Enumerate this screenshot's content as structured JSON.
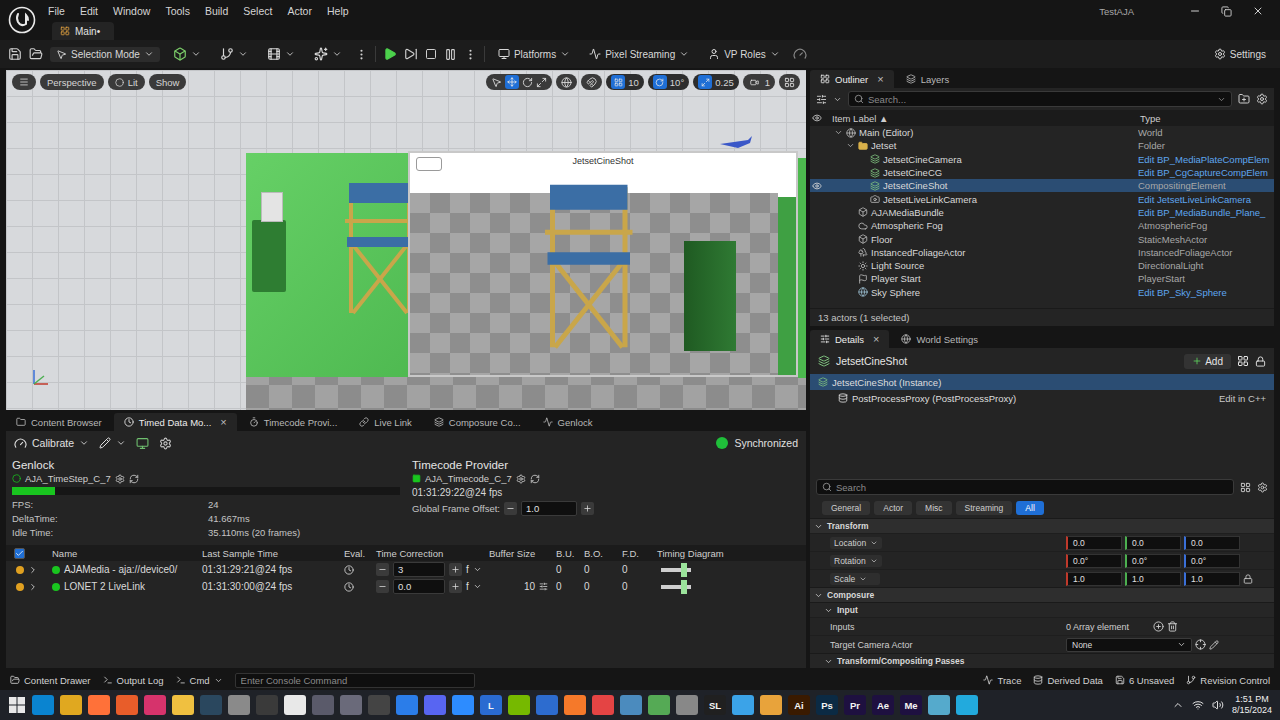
{
  "window": {
    "project": "TestAJA",
    "menu": [
      "File",
      "Edit",
      "Window",
      "Tools",
      "Build",
      "Select",
      "Actor",
      "Help"
    ],
    "tab": "Main•"
  },
  "toolbar": {
    "mode": "Selection Mode",
    "menus": [
      "Platforms",
      "Pixel Streaming",
      "VP Roles"
    ],
    "settings": "Settings"
  },
  "viewport": {
    "buttons": [
      "Perspective",
      "Lit",
      "Show"
    ],
    "snaps": [
      {
        "label": "10",
        "active": true
      },
      {
        "label": "10°",
        "active": true
      },
      {
        "label": "0.25",
        "active": true
      },
      {
        "label": "1",
        "active": false
      }
    ],
    "preview_label": "JetsetCineShot"
  },
  "bottom_panel": {
    "close_glyph": "×",
    "tabs": [
      {
        "label": "Content Browser",
        "selected": false,
        "closable": false
      },
      {
        "label": "Timed Data Mo...",
        "selected": true,
        "closable": true
      },
      {
        "label": "Timecode Provi...",
        "selected": false,
        "closable": false
      },
      {
        "label": "Live Link",
        "selected": false,
        "closable": false
      },
      {
        "label": "Composure Co...",
        "selected": false,
        "closable": false
      },
      {
        "label": "Genlock",
        "selected": false,
        "closable": false
      }
    ],
    "calibrate": "Calibrate",
    "status": {
      "label": "Synchronized",
      "color": "#1fbf3a"
    },
    "genlock": {
      "title": "Genlock",
      "source": "AJA_TimeStep_C_7",
      "level": 0.11,
      "stats": [
        {
          "label": "FPS:",
          "value": "24"
        },
        {
          "label": "DeltaTime:",
          "value": "41.667ms"
        },
        {
          "label": "Idle Time:",
          "value": "35.110ms (20 frames)"
        }
      ]
    },
    "timecode": {
      "title": "Timecode Provider",
      "source": "AJA_Timecode_C_7",
      "value": "01:31:29:22@24 fps",
      "offset_label": "Global Frame Offset:",
      "offset": "1.0"
    },
    "table": {
      "all_checked": true,
      "columns": [
        "Name",
        "Last Sample Time",
        "Eval.",
        "Time Correction",
        "Buffer Size",
        "B.U.",
        "B.O.",
        "F.D.",
        "Timing Diagram"
      ],
      "rows": [
        {
          "name": "AJAMedia - aja://device0/",
          "enabled": true,
          "synced": true,
          "last_sample": "01:31:29:21@24 fps",
          "time_correction": "3",
          "unit": "f",
          "bu": "0",
          "bo": "0",
          "fd": "0"
        },
        {
          "name": "LONET 2 LiveLink",
          "enabled": true,
          "synced": true,
          "last_sample": "01:31:30:00@24 fps",
          "time_correction": "0.0",
          "unit": "f",
          "buffer_size": "10",
          "bu": "0",
          "bo": "0",
          "fd": "0"
        }
      ]
    }
  },
  "outliner": {
    "close_glyph": "×",
    "tabs": [
      {
        "label": "Outliner",
        "selected": true
      },
      {
        "label": "Layers",
        "selected": false
      }
    ],
    "search_placeholder": "Search...",
    "columns": [
      "Item Label ▲",
      "Type"
    ],
    "rows": [
      {
        "label": "Main (Editor)",
        "type": "World",
        "depth": 0,
        "kind": "world",
        "link": false,
        "expanded": true,
        "selected": false,
        "visible": false
      },
      {
        "label": "Jetset",
        "type": "Folder",
        "depth": 1,
        "kind": "folder",
        "link": false,
        "expanded": true,
        "selected": false,
        "visible": false
      },
      {
        "label": "JetsetCineCamera",
        "type": "Edit BP_MediaPlateCompElem",
        "depth": 2,
        "kind": "composite",
        "link": true,
        "expanded": false,
        "selected": false,
        "visible": false
      },
      {
        "label": "JetsetCineCG",
        "type": "Edit BP_CgCaptureCompElem",
        "depth": 2,
        "kind": "composite",
        "link": true,
        "expanded": false,
        "selected": false,
        "visible": false
      },
      {
        "label": "JetsetCineShot",
        "type": "CompositingElement",
        "depth": 2,
        "kind": "composite",
        "link": false,
        "expanded": false,
        "selected": true,
        "visible": true
      },
      {
        "label": "JetsetLiveLinkCamera",
        "type": "Edit JetsetLiveLinkCamera",
        "depth": 2,
        "kind": "camera",
        "link": true,
        "expanded": false,
        "selected": false,
        "visible": false
      },
      {
        "label": "AJAMediaBundle",
        "type": "Edit BP_MediaBundle_Plane_",
        "depth": 1,
        "kind": "actor",
        "link": true,
        "expanded": false,
        "selected": false,
        "visible": false
      },
      {
        "label": "Atmospheric Fog",
        "type": "AtmosphericFog",
        "depth": 1,
        "kind": "fog",
        "link": false,
        "expanded": false,
        "selected": false,
        "visible": false
      },
      {
        "label": "Floor",
        "type": "StaticMeshActor",
        "depth": 1,
        "kind": "actor",
        "link": false,
        "expanded": false,
        "selected": false,
        "visible": false
      },
      {
        "label": "InstancedFoliageActor",
        "type": "InstancedFoliageActor",
        "depth": 1,
        "kind": "foliage",
        "link": false,
        "expanded": false,
        "selected": false,
        "visible": false
      },
      {
        "label": "Light Source",
        "type": "DirectionalLight",
        "depth": 1,
        "kind": "light",
        "link": false,
        "expanded": false,
        "selected": false,
        "visible": false
      },
      {
        "label": "Player Start",
        "type": "PlayerStart",
        "depth": 1,
        "kind": "start",
        "link": false,
        "expanded": false,
        "selected": false,
        "visible": false
      },
      {
        "label": "Sky Sphere",
        "type": "Edit BP_Sky_Sphere",
        "depth": 1,
        "kind": "sky",
        "link": true,
        "expanded": false,
        "selected": false,
        "visible": false
      }
    ],
    "footer": "13 actors (1 selected)"
  },
  "details": {
    "close_glyph": "×",
    "tabs": [
      {
        "label": "Details",
        "selected": true
      },
      {
        "label": "World Settings",
        "selected": false
      }
    ],
    "actor": "JetsetCineShot",
    "add": "Add",
    "components": [
      {
        "label": "JetsetCineShot (Instance)",
        "depth": 0,
        "selected": true
      },
      {
        "label": "PostProcessProxy (PostProcessProxy)",
        "depth": 1,
        "selected": false,
        "action": "Edit in C++"
      }
    ],
    "search_placeholder": "Search",
    "filters": [
      {
        "label": "General",
        "selected": false
      },
      {
        "label": "Actor",
        "selected": false
      },
      {
        "label": "Misc",
        "selected": false
      },
      {
        "label": "Streaming",
        "selected": false
      },
      {
        "label": "All",
        "selected": true
      }
    ],
    "sections": [
      {
        "title": "Transform",
        "level": 0,
        "rows": [
          {
            "label": "Location",
            "kind": "vector",
            "dropdown": true,
            "locked": false,
            "values": [
              "0.0",
              "0.0",
              "0.0"
            ]
          },
          {
            "label": "Rotation",
            "kind": "vector",
            "dropdown": true,
            "locked": false,
            "values": [
              "0.0°",
              "0.0°",
              "0.0°"
            ]
          },
          {
            "label": "Scale",
            "kind": "vector",
            "dropdown": true,
            "locked": true,
            "values": [
              "1.0",
              "1.0",
              "1.0"
            ]
          }
        ]
      },
      {
        "title": "Composure",
        "level": 0,
        "rows": []
      },
      {
        "title": "Input",
        "level": 1,
        "rows": [
          {
            "label": "Inputs",
            "kind": "array",
            "value": "0 Array element"
          },
          {
            "label": "Target Camera Actor",
            "kind": "select",
            "value": "None"
          }
        ]
      },
      {
        "title": "Transform/Compositing Passes",
        "level": 1,
        "rows": []
      }
    ]
  },
  "status_bar": {
    "left": [
      "Content Drawer",
      "Output Log",
      "Cmd"
    ],
    "console_placeholder": "Enter Console Command",
    "right": [
      "Trace",
      "Derived Data",
      "6 Unsaved",
      "Revision Control"
    ]
  },
  "taskbar": {
    "apps": [
      {
        "color": "#0a84d0"
      },
      {
        "color": "#e0a820"
      },
      {
        "color": "#ff7139"
      },
      {
        "color": "#e85d2a"
      },
      {
        "color": "#d6336c"
      },
      {
        "color": "#f0c040"
      },
      {
        "color": "#2a475e"
      },
      {
        "color": "#8a8a8a"
      },
      {
        "color": "#3a3a3a"
      },
      {
        "color": "#e8e8e8"
      },
      {
        "color": "#5a5a6a"
      },
      {
        "color": "#6a6a7a"
      },
      {
        "color": "#444444"
      },
      {
        "color": "#2b7de9"
      },
      {
        "color": "#5865f2"
      },
      {
        "color": "#2d8cff"
      },
      {
        "label": "L",
        "color": "#2a6bd1"
      },
      {
        "color": "#76b900"
      },
      {
        "color": "#2d6ccf"
      },
      {
        "color": "#f5792a"
      },
      {
        "color": "#e44444"
      },
      {
        "color": "#4b8bbe"
      },
      {
        "color": "#55aa55"
      },
      {
        "color": "#888888"
      },
      {
        "label": "SL",
        "color": "#202020"
      },
      {
        "color": "#3ba3e8"
      },
      {
        "color": "#e8a33b"
      },
      {
        "label": "Ai",
        "color": "#3a1a00"
      },
      {
        "label": "Ps",
        "color": "#0b2a44"
      },
      {
        "label": "Pr",
        "color": "#1e1040"
      },
      {
        "label": "Ae",
        "color": "#1e1040"
      },
      {
        "label": "Me",
        "color": "#1e1040"
      },
      {
        "color": "#55aacc"
      },
      {
        "color": "#22aadd"
      }
    ],
    "time": "1:51 PM",
    "date": "8/15/2024"
  }
}
